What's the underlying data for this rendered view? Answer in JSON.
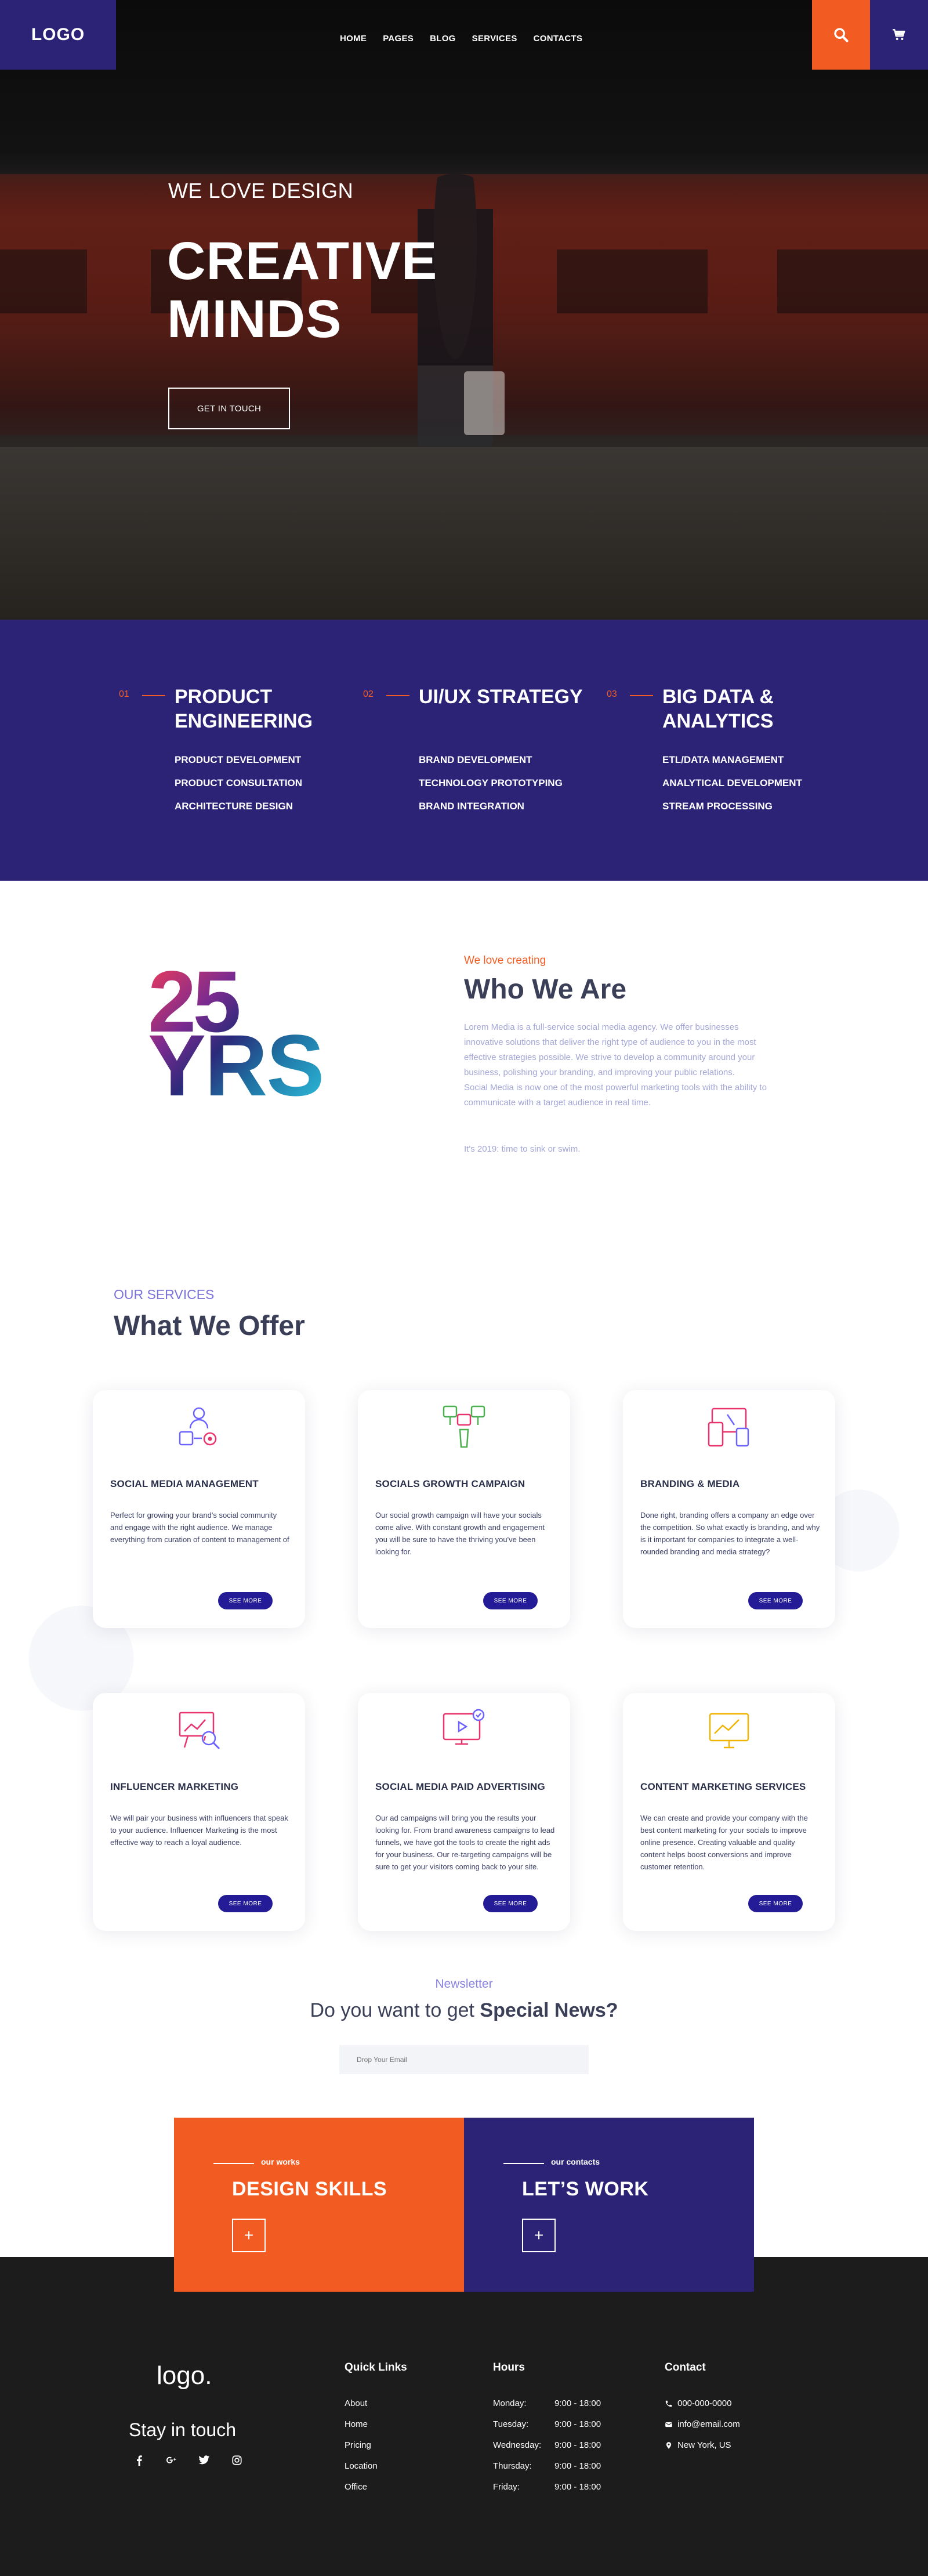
{
  "header": {
    "logo": "LOGO",
    "nav": [
      "HOME",
      "PAGES",
      "BLOG",
      "SERVICES",
      "CONTACTS"
    ]
  },
  "hero": {
    "tagline": "WE LOVE DESIGN",
    "title_line1": "CREATIVE",
    "title_line2": "MINDS",
    "button": "GET IN TOUCH"
  },
  "features": [
    {
      "number": "01",
      "title": "PRODUCT ENGINEERING",
      "items": [
        "PRODUCT DEVELOPMENT",
        "PRODUCT CONSULTATION",
        "ARCHITECTURE DESIGN"
      ]
    },
    {
      "number": "02",
      "title": "UI/UX STRATEGY",
      "items": [
        "BRAND DEVELOPMENT",
        "TECHNOLOGY PROTOTYPING",
        "BRAND INTEGRATION"
      ]
    },
    {
      "number": "03",
      "title": "BIG DATA & ANALYTICS",
      "items": [
        "ETL/DATA MANAGEMENT",
        "ANALYTICAL DEVELOPMENT",
        "STREAM PROCESSING"
      ]
    }
  ],
  "about": {
    "years_number": "25",
    "years_label": "YRS",
    "eyebrow": "We love creating",
    "title": "Who We Are",
    "paragraph1": "Lorem Media is a full-service social media agency. We offer businesses innovative solutions that deliver the right type of audience to you in the most effective strategies possible. We strive to develop a community around your business, polishing your branding, and improving your public relations.",
    "paragraph2": "Social Media is now one of the most powerful marketing tools with the ability to communicate with a target audience in real time.",
    "tagline": "It's 2019: time to sink or swim."
  },
  "services": {
    "eyebrow": "OUR SERVICES",
    "title": "What We Offer",
    "button_label": "SEE MORE",
    "cards": [
      {
        "title": "SOCIAL MEDIA MANAGEMENT",
        "text": "Perfect for growing your brand's social community and engage with the right audience. We manage everything from curation of content to management of",
        "icon": "social-management-icon",
        "color": "#6c63ff"
      },
      {
        "title": "SOCIALS GROWTH CAMPAIGN",
        "text": "Our social growth campaign will have your socials come alive. With constant growth and engagement you will be sure to have the thriving you've been looking for.",
        "icon": "growth-campaign-icon",
        "color": "#4caf50"
      },
      {
        "title": "BRANDING & MEDIA",
        "text": "Done right, branding offers a company an edge over the competition. So what exactly is branding, and why is it important for companies to integrate a well-rounded branding and media strategy?",
        "icon": "branding-devices-icon",
        "color": "#e8336d"
      },
      {
        "title": "INFLUENCER MARKETING",
        "text": "We will pair your business with influencers that speak to your audience. Influencer Marketing is the most effective way to reach a loyal audience.",
        "icon": "influencer-presentation-icon",
        "color": "#e8336d"
      },
      {
        "title": "SOCIAL MEDIA PAID ADVERTISING",
        "text": "Our ad campaigns will bring you the results your looking for. From brand awareness campaigns to lead funnels, we have got the tools to create the right ads for your business. Our re-targeting campaigns will be sure to get your visitors coming back to your site.",
        "icon": "paid-advertising-icon",
        "color": "#e8336d"
      },
      {
        "title": "CONTENT MARKETING SERVICES",
        "text": "We can create and provide your company with the best content marketing for your socials to improve online presence. Creating valuable and quality content helps boost conversions and improve customer retention.",
        "icon": "content-chart-icon",
        "color": "#f0b400"
      }
    ]
  },
  "newsletter": {
    "eyebrow": "Newsletter",
    "title_prefix": "Do you want to get ",
    "title_bold": "Special News?",
    "placeholder": "Drop Your Email"
  },
  "cta": {
    "left": {
      "label": "our works",
      "title": "DESIGN SKILLS",
      "plus": "+"
    },
    "right": {
      "label": "our contacts",
      "title": "LET’S WORK",
      "plus": "+"
    }
  },
  "footer": {
    "logo": "logo.",
    "stay": "Stay in touch",
    "social": [
      "facebook-icon",
      "google-icon",
      "twitter-icon",
      "instagram-icon"
    ],
    "quick_links_title": "Quick Links",
    "quick_links": [
      "About",
      "Home",
      "Pricing",
      "Location",
      "Office"
    ],
    "hours_title": "Hours",
    "hours": [
      {
        "day": "Monday:",
        "time": "9:00 - 18:00"
      },
      {
        "day": "Tuesday:",
        "time": "9:00 - 18:00"
      },
      {
        "day": "Wednesday:",
        "time": "9:00 - 18:00"
      },
      {
        "day": "Thursday:",
        "time": "9:00 - 18:00"
      },
      {
        "day": "Friday:",
        "time": "9:00 - 18:00"
      }
    ],
    "contact_title": "Contact",
    "phone": "000-000-0000",
    "email": "info@email.com",
    "location": "New York, US"
  },
  "colors": {
    "brand_purple": "#2c2377",
    "accent_orange": "#f25c22",
    "button_blue": "#241c97",
    "footer_dark": "#1c1c1c"
  }
}
